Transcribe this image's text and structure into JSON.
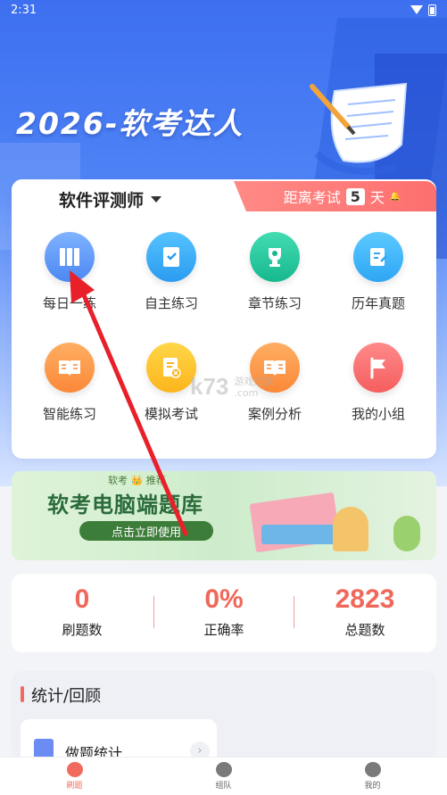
{
  "status_bar": {
    "time": "2:31"
  },
  "hero": {
    "title": "2026-软考达人"
  },
  "subject_selector": {
    "label": "软件评测师"
  },
  "exam_countdown": {
    "prefix": "距离考试",
    "days": "5",
    "suffix": "天"
  },
  "practice_grid": [
    {
      "label": "每日一练",
      "icon": "books-icon",
      "color": "#4c88f2"
    },
    {
      "label": "自主练习",
      "icon": "bookmark-check-icon",
      "color": "#2b9cf0"
    },
    {
      "label": "章节练习",
      "icon": "trophy-icon",
      "color": "#17b88e"
    },
    {
      "label": "历年真题",
      "icon": "notebook-pen-icon",
      "color": "#2ea6f5"
    },
    {
      "label": "智能练习",
      "icon": "open-book-icon",
      "color": "#fb8839"
    },
    {
      "label": "模拟考试",
      "icon": "exam-paper-icon",
      "color": "#fcb51c"
    },
    {
      "label": "案例分析",
      "icon": "open-book-icon",
      "color": "#fb8839"
    },
    {
      "label": "我的小组",
      "icon": "flag-icon",
      "color": "#f55e5e"
    }
  ],
  "watermark": {
    "logo": "k73",
    "line1": "游戏之家",
    "line2": ".com"
  },
  "banner": {
    "tagline": "软考 👑 推荐",
    "headline": "软考电脑端题库",
    "cta": "点击立即使用"
  },
  "stats": [
    {
      "value": "0",
      "label": "刷题数"
    },
    {
      "value": "0%",
      "label": "正确率"
    },
    {
      "value": "2823",
      "label": "总题数"
    }
  ],
  "review": {
    "title": "统计/回顾",
    "card_title": "做题统计"
  },
  "tabbar": [
    {
      "label": "刷题",
      "active": true
    },
    {
      "label": "组队",
      "active": false
    },
    {
      "label": "我的",
      "active": false
    }
  ],
  "colors": {
    "accent": "#f06b5d",
    "primary_blue": "#3d6ff0",
    "arrow": "#e8202a"
  }
}
